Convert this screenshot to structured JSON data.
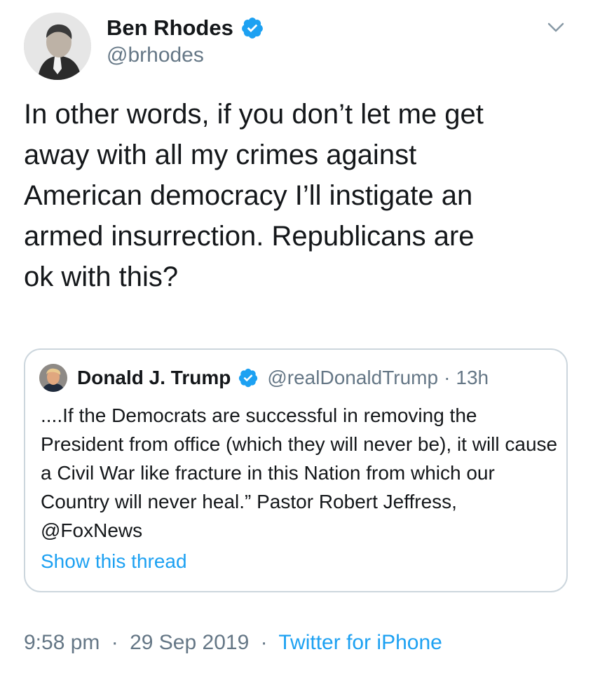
{
  "author": {
    "name": "Ben Rhodes",
    "handle": "@brhodes"
  },
  "tweet": {
    "text": "In other words, if you don’t let me get\naway with all my crimes against\nAmerican democracy I’ll instigate an\narmed insurrection. Republicans are\nok with this?"
  },
  "quoted_tweet": {
    "name": "Donald J. Trump",
    "handle": "@realDonaldTrump",
    "separator": "·",
    "time": "13h",
    "text": "....If the Democrats are successful in removing the President from office (which they will never be), it will cause a Civil War like fracture in this Nation from which our Country will never heal.” Pastor Robert Jeffress, @FoxNews",
    "show_thread": "Show this thread"
  },
  "footer": {
    "time": "9:58 pm",
    "dot1": "·",
    "date": "29 Sep 2019",
    "dot2": "·",
    "source": "Twitter for iPhone"
  },
  "icons": {
    "verified": "verified-badge-icon",
    "caret": "chevron-down-icon"
  },
  "colors": {
    "accent": "#1da1f2",
    "secondary_text": "#657786",
    "border": "#ccd6dd"
  }
}
